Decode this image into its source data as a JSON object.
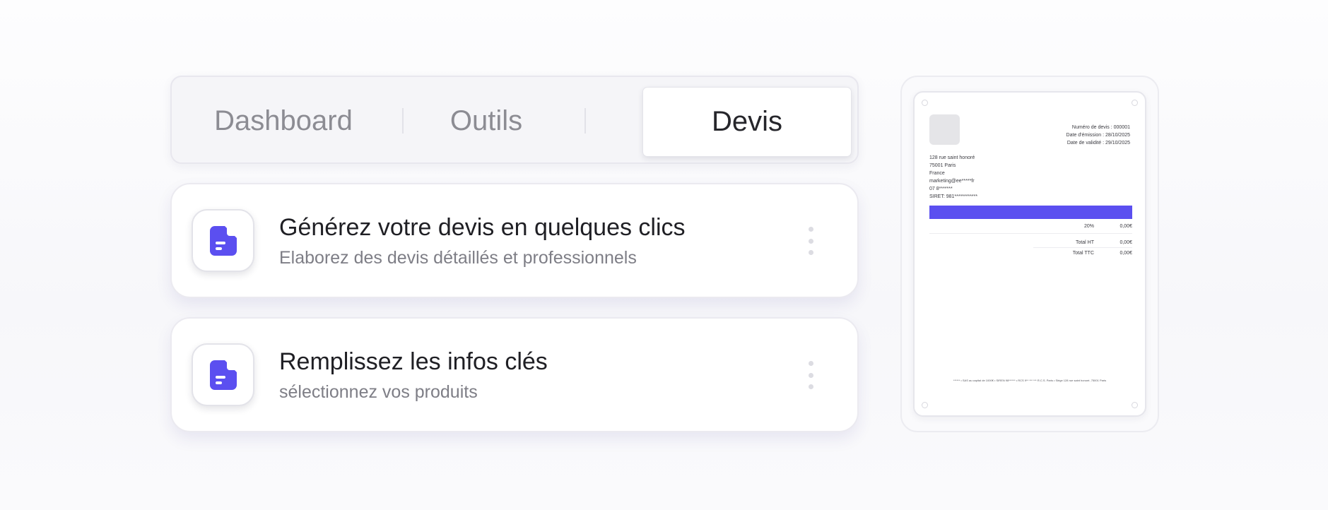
{
  "tabs": {
    "dashboard": "Dashboard",
    "outils": "Outils",
    "devis": "Devis",
    "active": "Devis"
  },
  "steps": [
    {
      "title": "Générez votre devis en quelques clics",
      "subtitle": "Elaborez des devis détaillés et professionnels",
      "icon": "document-icon"
    },
    {
      "title": "Remplissez les infos clés",
      "subtitle": "sélectionnez vos produits",
      "icon": "document-icon"
    }
  ],
  "quote_preview": {
    "number": "Numéro de devis : 000001",
    "issue_date": "Date d'émission : 28/10/2025",
    "validity_date": "Date de validité : 29/10/2025",
    "issuer": {
      "street": "128 rue saint honoré",
      "city": "75001 Paris",
      "country": "France",
      "email": "marketing@ee*****fr",
      "phone": "07 8*******",
      "siret": "SIRET: 981************"
    },
    "vat_rate": "20%",
    "vat_amount": "0,00€",
    "total_ht_label": "Total HT",
    "total_ht": "0,00€",
    "total_ttc_label": "Total TTC",
    "total_ttc": "0,00€",
    "footer": "****** • SAS au capital de 1000€ • SIREN 98****** • RCS 9** *** *** R.C.S. Paris • Siège 128 rue saint honoré, 75001 Paris"
  },
  "colors": {
    "accent": "#5b4ff0",
    "title_text": "#1f1f24",
    "muted_text": "#7e7e86",
    "inactive_tab": "#8c8c93"
  }
}
